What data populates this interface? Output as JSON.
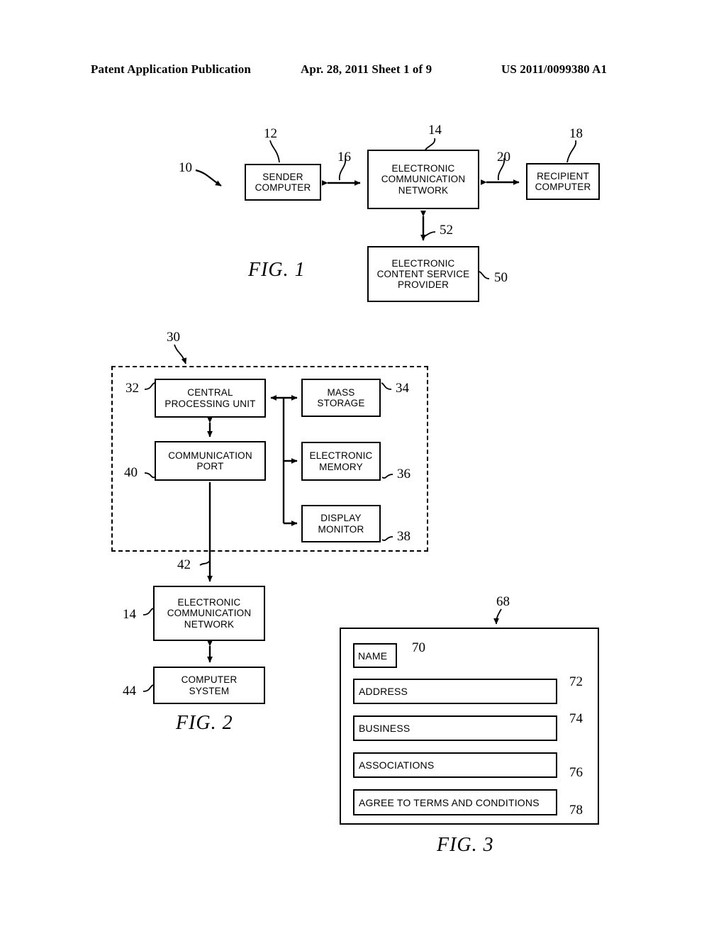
{
  "header": {
    "publication": "Patent Application Publication",
    "date_sheet": "Apr. 28, 2011  Sheet 1 of 9",
    "pub_number": "US 2011/0099380 A1"
  },
  "figures": [
    {
      "caption": "FIG. 1",
      "system_ref": "10",
      "blocks": [
        {
          "ref": "12",
          "lines": [
            "SENDER",
            "COMPUTER"
          ]
        },
        {
          "ref": "14",
          "lines": [
            "ELECTRONIC",
            "COMMUNICATION",
            "NETWORK"
          ]
        },
        {
          "ref": "18",
          "lines": [
            "RECIPIENT",
            "COMPUTER"
          ]
        },
        {
          "ref": "50",
          "lines": [
            "ELECTRONIC",
            "CONTENT SERVICE",
            "PROVIDER"
          ]
        }
      ],
      "links": [
        {
          "ref": "16",
          "from": "12",
          "to": "14"
        },
        {
          "ref": "20",
          "from": "14",
          "to": "18"
        },
        {
          "ref": "52",
          "from": "14",
          "to": "50"
        }
      ]
    },
    {
      "caption": "FIG. 2",
      "enclosure_ref": "30",
      "blocks": [
        {
          "ref": "32",
          "lines": [
            "CENTRAL",
            "PROCESSING UNIT"
          ]
        },
        {
          "ref": "34",
          "lines": [
            "MASS",
            "STORAGE"
          ]
        },
        {
          "ref": "36",
          "lines": [
            "ELECTRONIC",
            "MEMORY"
          ]
        },
        {
          "ref": "38",
          "lines": [
            "DISPLAY",
            "MONITOR"
          ]
        },
        {
          "ref": "40",
          "lines": [
            "COMMUNICATION",
            "PORT"
          ]
        },
        {
          "ref": "14",
          "lines": [
            "ELECTRONIC",
            "COMMUNICATION",
            "NETWORK"
          ]
        },
        {
          "ref": "44",
          "lines": [
            "COMPUTER",
            "SYSTEM"
          ]
        }
      ],
      "links": [
        {
          "ref": "42",
          "from": "40",
          "to": "14"
        }
      ]
    },
    {
      "caption": "FIG. 3",
      "panel_ref": "68",
      "fields": [
        {
          "ref": "70",
          "label": "NAME"
        },
        {
          "ref": "72",
          "label": "ADDRESS"
        },
        {
          "ref": "74",
          "label": "BUSINESS"
        },
        {
          "ref": "76",
          "label": "ASSOCIATIONS"
        },
        {
          "ref": "78",
          "label": "AGREE TO TERMS AND CONDITIONS"
        }
      ]
    }
  ]
}
